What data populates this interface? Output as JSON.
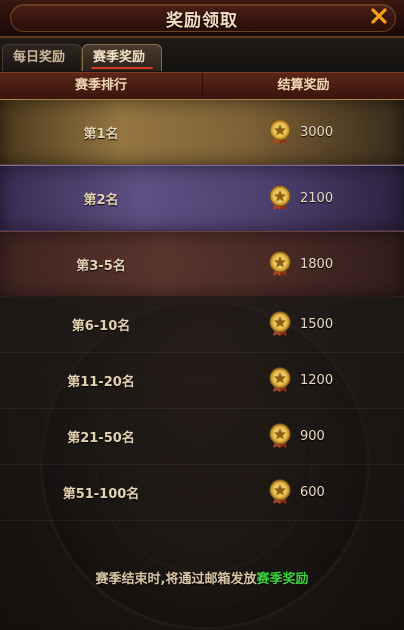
{
  "window": {
    "title": "奖励领取"
  },
  "tabs": [
    {
      "label": "每日奖励",
      "active": false
    },
    {
      "label": "赛季奖励",
      "active": true
    }
  ],
  "table": {
    "headers": {
      "rank": "赛季排行",
      "reward": "结算奖励"
    },
    "rows": [
      {
        "rank": "第1名",
        "amount": "3000"
      },
      {
        "rank": "第2名",
        "amount": "2100"
      },
      {
        "rank": "第3-5名",
        "amount": "1800"
      },
      {
        "rank": "第6-10名",
        "amount": "1500"
      },
      {
        "rank": "第11-20名",
        "amount": "1200"
      },
      {
        "rank": "第21-50名",
        "amount": "900"
      },
      {
        "rank": "第51-100名",
        "amount": "600"
      }
    ]
  },
  "footer": {
    "text": "赛季结束时,将通过邮箱发放",
    "highlight": "赛季奖励"
  },
  "icons": {
    "close": "close-icon",
    "medal": "star-medal-icon"
  },
  "colors": {
    "highlight": "#3fd23f",
    "close": "#f2a21a"
  }
}
